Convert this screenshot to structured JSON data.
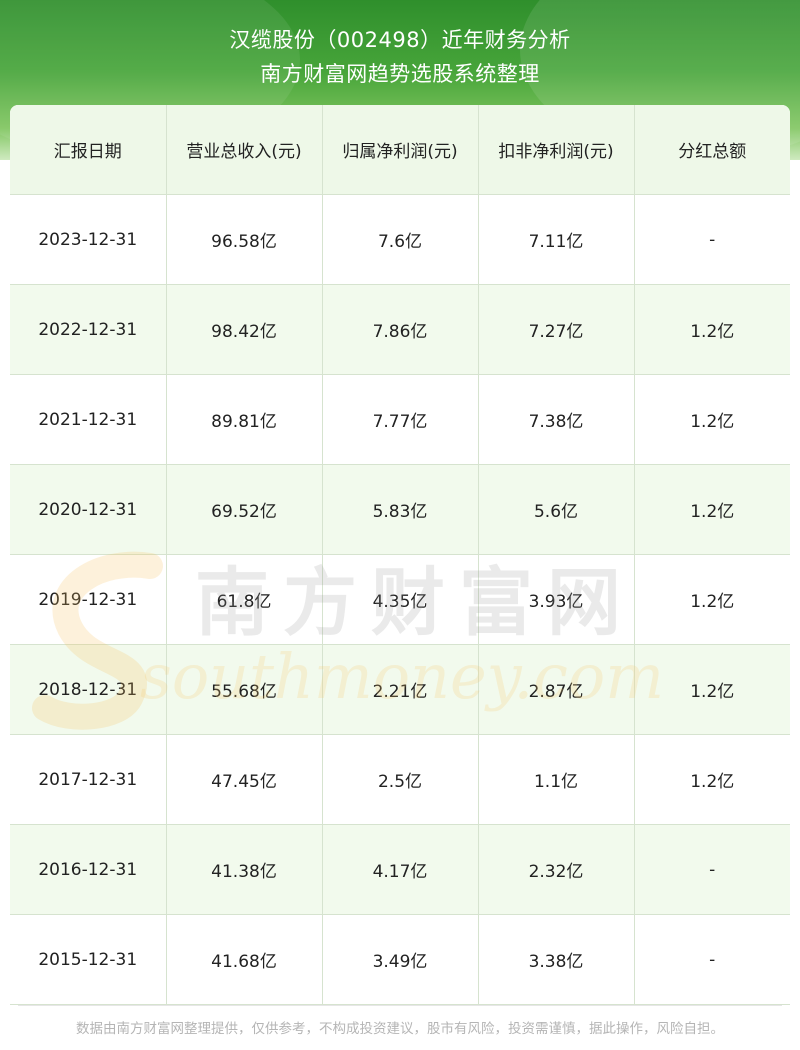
{
  "header": {
    "title": "汉缆股份（002498）近年财务分析",
    "subtitle": "南方财富网趋势选股系统整理"
  },
  "table": {
    "columns": [
      "汇报日期",
      "营业总收入(元)",
      "归属净利润(元)",
      "扣非净利润(元)",
      "分红总额"
    ],
    "rows": [
      [
        "2023-12-31",
        "96.58亿",
        "7.6亿",
        "7.11亿",
        "-"
      ],
      [
        "2022-12-31",
        "98.42亿",
        "7.86亿",
        "7.27亿",
        "1.2亿"
      ],
      [
        "2021-12-31",
        "89.81亿",
        "7.77亿",
        "7.38亿",
        "1.2亿"
      ],
      [
        "2020-12-31",
        "69.52亿",
        "5.83亿",
        "5.6亿",
        "1.2亿"
      ],
      [
        "2019-12-31",
        "61.8亿",
        "4.35亿",
        "3.93亿",
        "1.2亿"
      ],
      [
        "2018-12-31",
        "55.68亿",
        "2.21亿",
        "2.87亿",
        "1.2亿"
      ],
      [
        "2017-12-31",
        "47.45亿",
        "2.5亿",
        "1.1亿",
        "1.2亿"
      ],
      [
        "2016-12-31",
        "41.38亿",
        "4.17亿",
        "2.32亿",
        "-"
      ],
      [
        "2015-12-31",
        "41.68亿",
        "3.49亿",
        "3.38亿",
        "-"
      ]
    ]
  },
  "watermark": {
    "cn": "南方财富网",
    "en": "southmoney.com"
  },
  "footer": {
    "disclaimer": "数据由南方财富网整理提供，仅供参考，不构成投资建议，股市有风险，投资需谨慎，据此操作，风险自担。"
  },
  "colors": {
    "header_green": "#3f9e35",
    "row_alt": "#f2faed",
    "grid": "#d6e3cf"
  }
}
